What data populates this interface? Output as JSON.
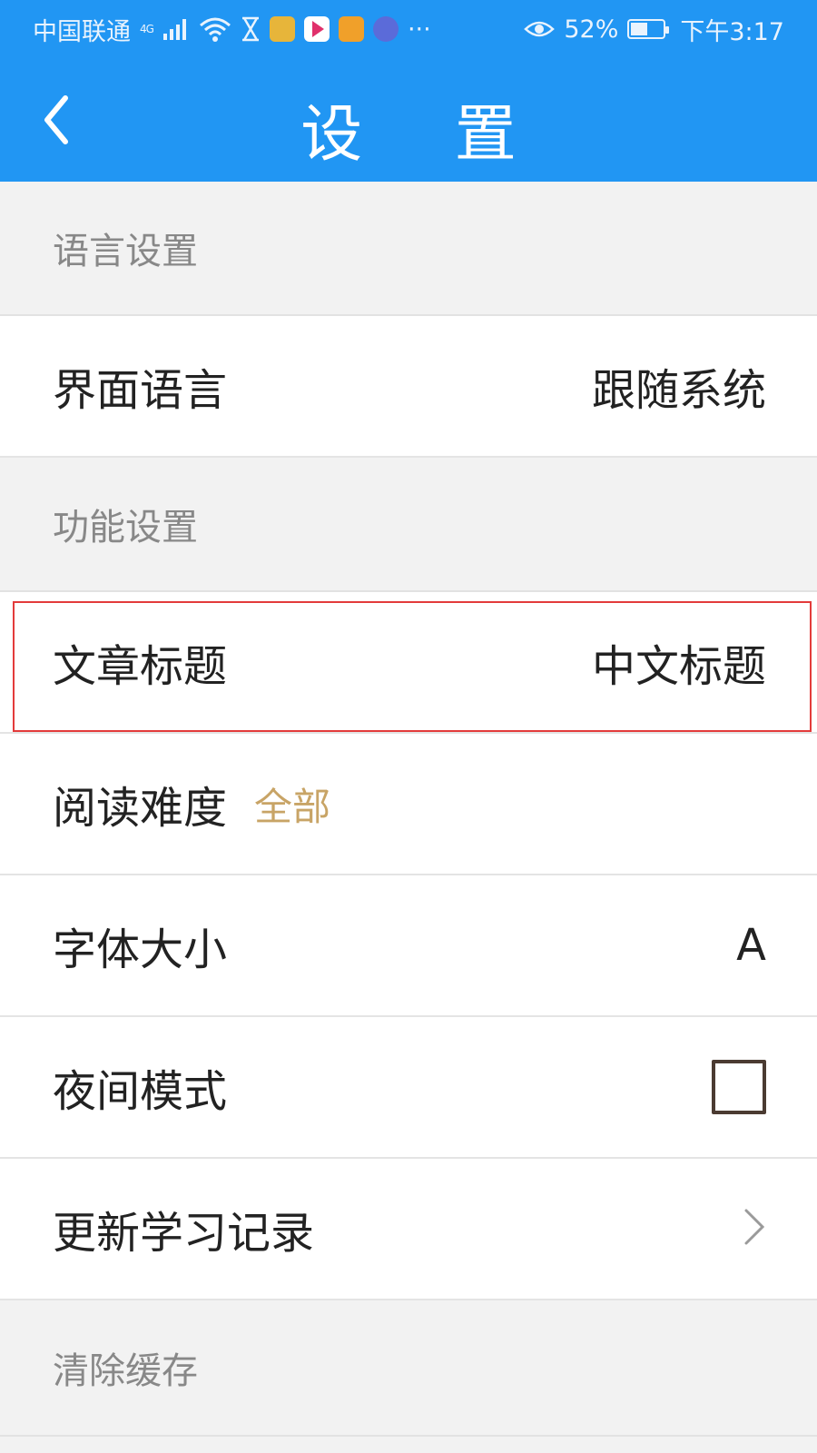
{
  "status_bar": {
    "carrier": "中国联通",
    "network": "4G",
    "battery": "52%",
    "battery_level": 0.52,
    "time": "下午3:17",
    "more": "···"
  },
  "header": {
    "title": "设 置",
    "back_icon": "chevron-left-icon",
    "background_color": "#2196f3"
  },
  "sections": {
    "language": {
      "header": "语言设置",
      "ui_language": {
        "label": "界面语言",
        "value": "跟随系统"
      }
    },
    "features": {
      "header": "功能设置",
      "article_title": {
        "label": "文章标题",
        "value": "中文标题",
        "highlight_color": "#e33b3b"
      },
      "reading_difficulty": {
        "label": "阅读难度",
        "value": "全部"
      },
      "font_size": {
        "label": "字体大小",
        "value": "A"
      },
      "night_mode": {
        "label": "夜间模式",
        "checked": false
      },
      "update_records": {
        "label": "更新学习记录",
        "icon": "chevron-right-icon"
      }
    },
    "cache": {
      "header": "清除缓存"
    }
  }
}
